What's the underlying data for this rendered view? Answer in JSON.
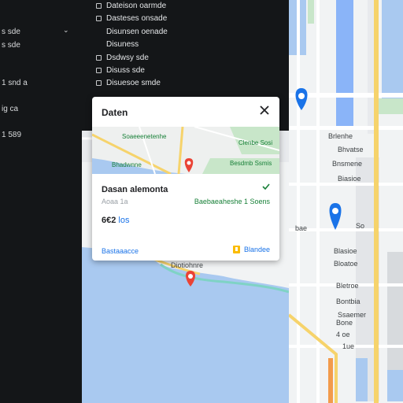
{
  "sidebar": {
    "left_labels": [
      {
        "text": "s  sde"
      },
      {
        "text": "s  sde"
      },
      {
        "text": "1 snd a"
      },
      {
        "text": "ig  ca"
      },
      {
        "text": "1 589"
      }
    ],
    "items": [
      {
        "label": "Dateison oarmde",
        "icon": "square-outline-icon"
      },
      {
        "label": "Dasteses onsade",
        "icon": "square-outline-icon"
      },
      {
        "label": "Disunsen oenade",
        "icon": "none"
      },
      {
        "label": "Disuness",
        "icon": "none"
      },
      {
        "label": "Dsdwsy sde",
        "icon": "square-outline-icon"
      },
      {
        "label": "Disuss sde",
        "icon": "square-outline-icon"
      },
      {
        "label": "Disuesoe smde",
        "icon": "square-outline-icon"
      }
    ]
  },
  "popup": {
    "title": "Daten",
    "close_icon": "close-icon",
    "map_labels": [
      "Soaeeenetenhe",
      "Clenbe Sosi",
      "Bhadwnne",
      "Bieae",
      "Besdmb Ssmis"
    ],
    "destination_name": "Dasan alemonta",
    "destination_address": "Aoaa 1a",
    "destination_status": "Baebaeaheshe 1 Soens",
    "distance_value": "6€2",
    "distance_unit": "los",
    "directions_label": "Bastaaacce",
    "share_label": "Blandee"
  },
  "map": {
    "main_label": "Diotiohnre",
    "right_labels": [
      "bae",
      "Brlenhe",
      "Bhvatse",
      "Bnsmene",
      "Biasioe",
      "So",
      "Blasioe",
      "Bloatoe",
      "Bletroe",
      "Bontbia",
      "Ssaemer",
      "Bone",
      "4  oe",
      "1ue"
    ]
  },
  "colors": {
    "water": "#a9c9f0",
    "park": "#c8e6c9",
    "road_major": "#f6d36b",
    "pin_blue": "#1a73e8",
    "pin_red": "#ea4335",
    "sidebar_bg": "#141618"
  }
}
